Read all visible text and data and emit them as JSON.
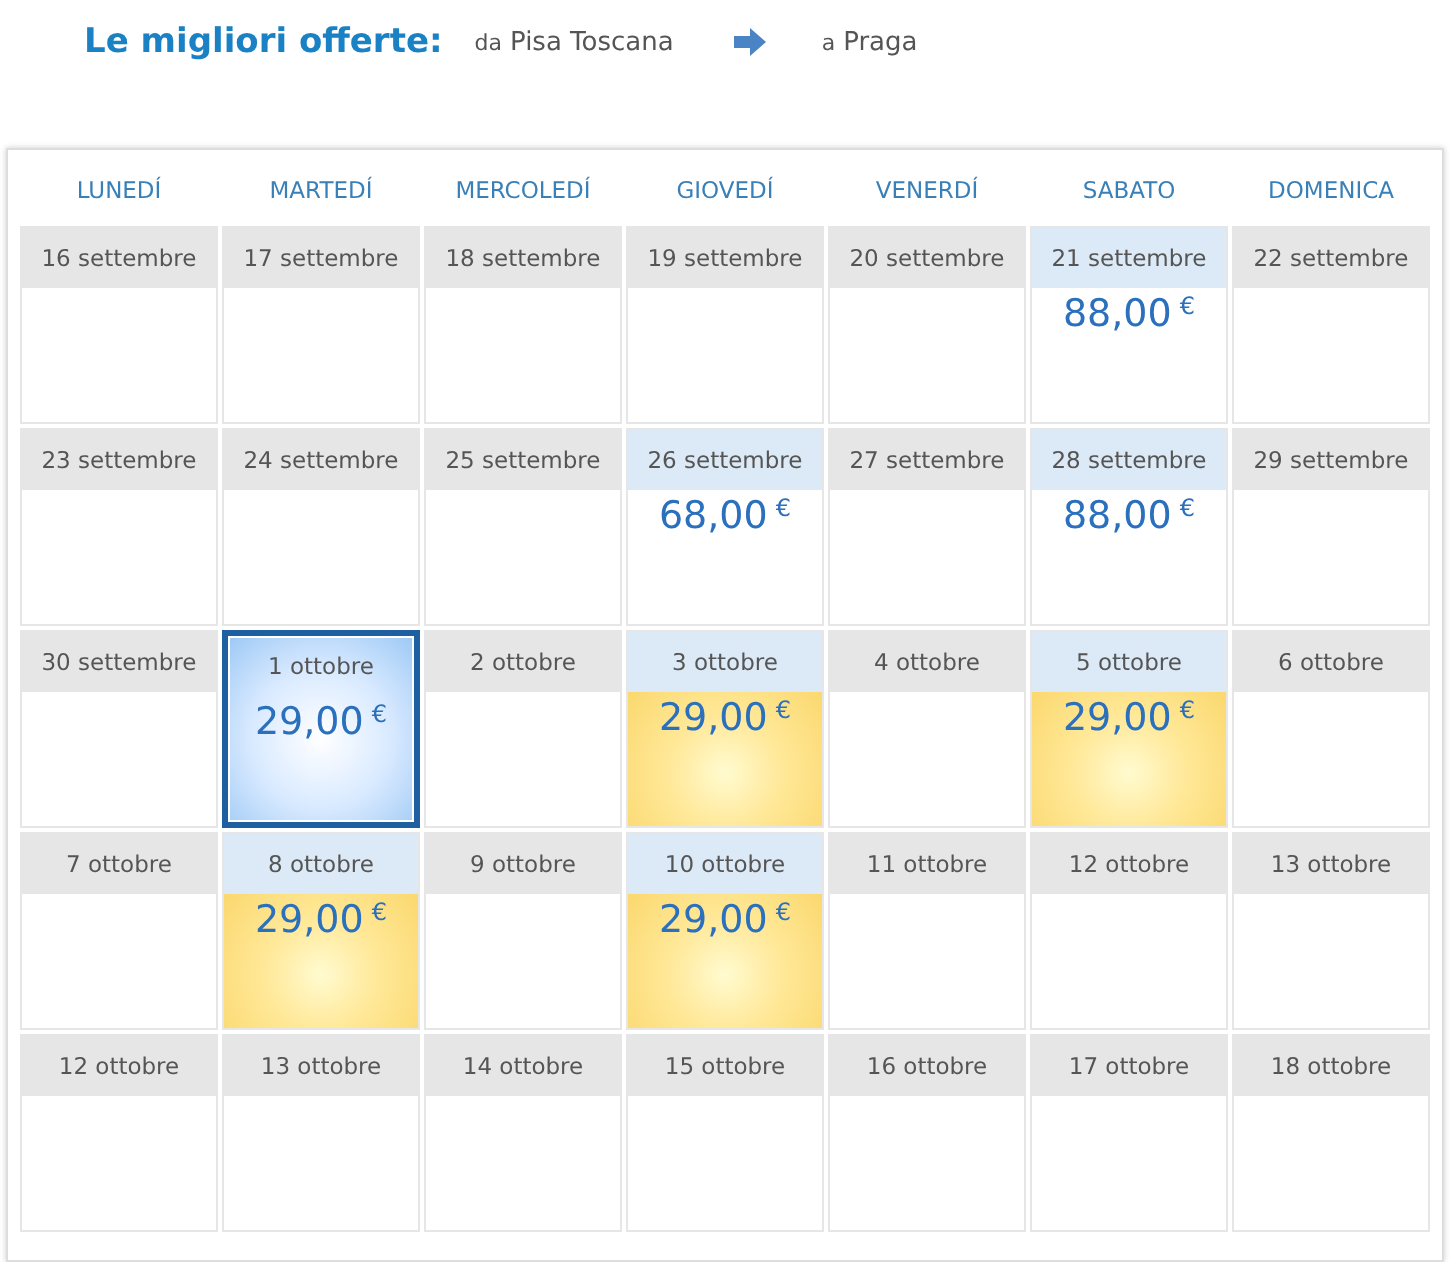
{
  "header": {
    "title": "Le migliori offerte:",
    "from_prefix": "da",
    "from": "Pisa Toscana",
    "to_prefix": "a",
    "to": "Praga"
  },
  "weekdays": [
    "LUNEDÍ",
    "MARTEDÍ",
    "MERCOLEDÍ",
    "GIOVEDÍ",
    "VENERDÍ",
    "SABATO",
    "DOMENICA"
  ],
  "weeks": [
    [
      {
        "date": "16 settembre",
        "kind": "plain",
        "selected": false
      },
      {
        "date": "17 settembre",
        "kind": "plain",
        "selected": false
      },
      {
        "date": "18 settembre",
        "kind": "plain",
        "selected": false
      },
      {
        "date": "19 settembre",
        "kind": "plain",
        "selected": false
      },
      {
        "date": "20 settembre",
        "kind": "plain",
        "selected": false
      },
      {
        "date": "21 settembre",
        "kind": "price",
        "selected": false,
        "price": "88,00",
        "currency": "€"
      },
      {
        "date": "22 settembre",
        "kind": "plain",
        "selected": false
      }
    ],
    [
      {
        "date": "23 settembre",
        "kind": "plain",
        "selected": false
      },
      {
        "date": "24 settembre",
        "kind": "plain",
        "selected": false
      },
      {
        "date": "25 settembre",
        "kind": "plain",
        "selected": false
      },
      {
        "date": "26 settembre",
        "kind": "price",
        "selected": false,
        "price": "68,00",
        "currency": "€"
      },
      {
        "date": "27 settembre",
        "kind": "plain",
        "selected": false
      },
      {
        "date": "28 settembre",
        "kind": "price",
        "selected": false,
        "price": "88,00",
        "currency": "€"
      },
      {
        "date": "29 settembre",
        "kind": "plain",
        "selected": false
      }
    ],
    [
      {
        "date": "30 settembre",
        "kind": "plain",
        "selected": false
      },
      {
        "date": "1 ottobre",
        "kind": "price",
        "selected": true,
        "price": "29,00",
        "currency": "€"
      },
      {
        "date": "2 ottobre",
        "kind": "plain",
        "selected": false
      },
      {
        "date": "3 ottobre",
        "kind": "cheapest",
        "selected": false,
        "price": "29,00",
        "currency": "€"
      },
      {
        "date": "4 ottobre",
        "kind": "plain",
        "selected": false
      },
      {
        "date": "5 ottobre",
        "kind": "cheapest",
        "selected": false,
        "price": "29,00",
        "currency": "€"
      },
      {
        "date": "6 ottobre",
        "kind": "plain",
        "selected": false
      }
    ],
    [
      {
        "date": "7 ottobre",
        "kind": "plain",
        "selected": false
      },
      {
        "date": "8 ottobre",
        "kind": "cheapest",
        "selected": false,
        "price": "29,00",
        "currency": "€"
      },
      {
        "date": "9 ottobre",
        "kind": "plain",
        "selected": false
      },
      {
        "date": "10 ottobre",
        "kind": "cheapest",
        "selected": false,
        "price": "29,00",
        "currency": "€"
      },
      {
        "date": "11 ottobre",
        "kind": "plain",
        "selected": false
      },
      {
        "date": "12 ottobre",
        "kind": "plain",
        "selected": false
      },
      {
        "date": "13 ottobre",
        "kind": "plain",
        "selected": false
      }
    ],
    [
      {
        "date": "12 ottobre",
        "kind": "plain",
        "selected": false
      },
      {
        "date": "13 ottobre",
        "kind": "plain",
        "selected": false
      },
      {
        "date": "14 ottobre",
        "kind": "plain",
        "selected": false
      },
      {
        "date": "15 ottobre",
        "kind": "plain",
        "selected": false
      },
      {
        "date": "16 ottobre",
        "kind": "plain",
        "selected": false
      },
      {
        "date": "17 ottobre",
        "kind": "plain",
        "selected": false
      },
      {
        "date": "18 ottobre",
        "kind": "plain",
        "selected": false
      }
    ]
  ]
}
